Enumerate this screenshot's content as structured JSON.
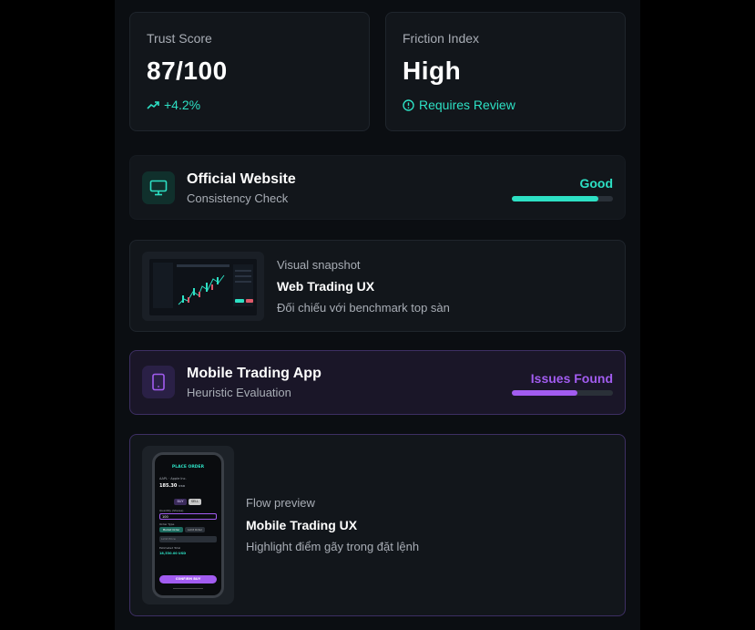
{
  "stats": {
    "trust": {
      "label": "Trust Score",
      "value": "87/100",
      "change": "+4.2%"
    },
    "friction": {
      "label": "Friction Index",
      "value": "High",
      "note": "Requires Review"
    }
  },
  "website": {
    "title": "Official Website",
    "subtitle": "Consistency Check",
    "status": "Good",
    "progress": 0.86,
    "status_color": "#2de0c4"
  },
  "web_snapshot": {
    "label": "Visual snapshot",
    "title": "Web Trading UX",
    "description": "Đối chiếu với benchmark top sàn"
  },
  "mobile": {
    "title": "Mobile Trading App",
    "subtitle": "Heuristic Evaluation",
    "status": "Issues Found",
    "progress": 0.65,
    "status_color": "#a25cf0"
  },
  "flow": {
    "label": "Flow preview",
    "title": "Mobile Trading UX",
    "description": "Highlight điểm gãy trong đặt lệnh"
  },
  "phone_screen": {
    "header": "PLACE ORDER",
    "pair": "AAPL · Apple Inc.",
    "price": "185.30",
    "price_unit": "USD",
    "buy_tab": "BUY",
    "sell_tab": "SELL",
    "qty_label": "Quantity (Shares)",
    "qty_value": "100",
    "order_type_label": "Order Type",
    "order_type_a": "Market Order",
    "order_type_b": "Limit Order",
    "limit_placeholder": "Limit Price",
    "total_label": "Estimated Total",
    "total_value": "18,530.00 USD",
    "confirm": "CONFIRM BUY"
  },
  "colors": {
    "accent_teal": "#2de0c4",
    "accent_purple": "#a25cf0",
    "panel_bg": "#0b0e12",
    "card_bg": "#12161b"
  }
}
